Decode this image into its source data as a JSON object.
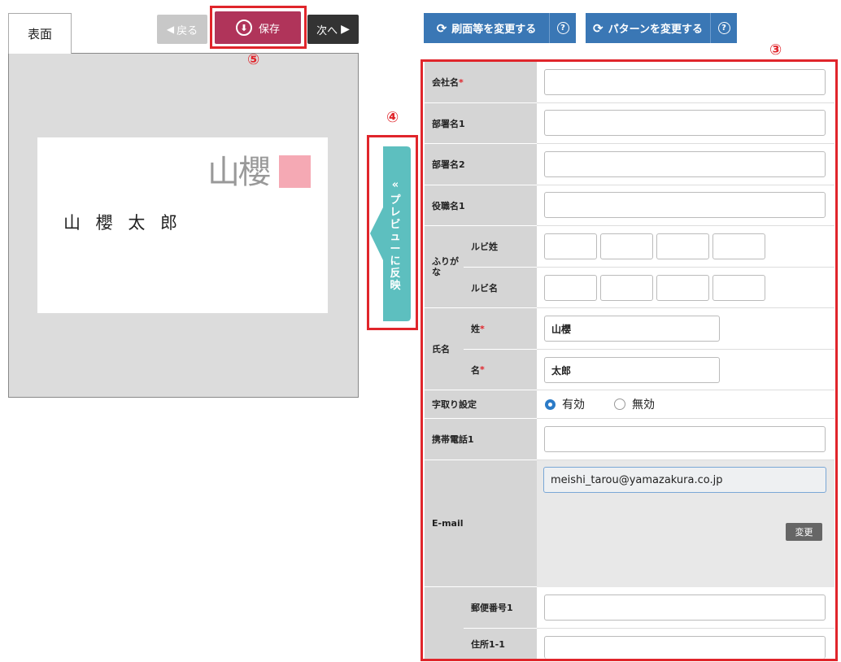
{
  "preview": {
    "tab_label": "表面",
    "logo_text": "山櫻",
    "card_name": "山 櫻 太 郎",
    "reflect_label": [
      "«",
      "プ",
      "レ",
      "ビ",
      "ュ",
      "ー",
      "に",
      "反",
      "映"
    ]
  },
  "nav": {
    "back_label": "戻る",
    "save_label": "保存",
    "next_label": "次へ"
  },
  "annotations": {
    "n3": "③",
    "n4": "④",
    "n5": "⑤"
  },
  "toolbar": {
    "change_paper_label": "刷面等を変更する",
    "change_pattern_label": "パターンを変更する",
    "help": "?"
  },
  "form": {
    "company": {
      "label": "会社名",
      "required": "*",
      "value": ""
    },
    "dept1": {
      "label": "部署名1",
      "value": ""
    },
    "dept2": {
      "label": "部署名2",
      "value": ""
    },
    "title1": {
      "label": "役職名1",
      "value": ""
    },
    "furigana": {
      "label": "ふりがな",
      "sei_label": "ルビ姓",
      "mei_label": "ルビ名"
    },
    "name": {
      "label": "氏名",
      "sei_label": "姓",
      "sei_value": "山櫻",
      "mei_label": "名",
      "mei_value": "太郎",
      "required": "*"
    },
    "spacing": {
      "label": "字取り設定",
      "on": "有効",
      "off": "無効"
    },
    "mobile1": {
      "label": "携帯電話1",
      "value": ""
    },
    "email": {
      "label": "E-mail",
      "value": "meishi_tarou@yamazakura.co.jp",
      "change_label": "変更"
    },
    "postal": {
      "label": "郵便番号1",
      "value": ""
    },
    "address": {
      "label": "住所1-1",
      "value": ""
    }
  }
}
